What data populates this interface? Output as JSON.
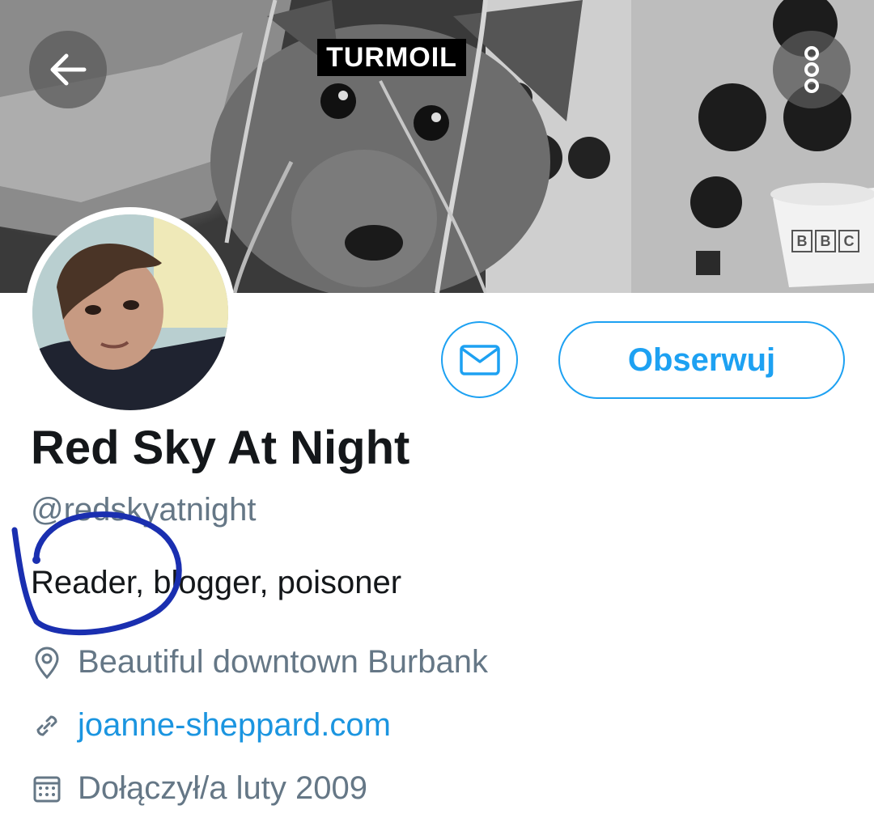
{
  "banner": {
    "title": "TURMOIL",
    "cup_logo": [
      "B",
      "B",
      "C"
    ]
  },
  "nav": {
    "back_icon": "arrow-left-icon",
    "more_icon": "more-vertical-icon"
  },
  "actions": {
    "message_icon": "envelope-icon",
    "follow_label": "Obserwuj"
  },
  "profile": {
    "name": "Red Sky At Night",
    "handle": "@redskyatnight",
    "bio": "Reader, blogger, poisoner",
    "location": "Beautiful downtown Burbank",
    "website": "joanne-sheppard.com",
    "joined": "Dołączył/a luty 2009"
  },
  "colors": {
    "accent": "#1da1f2",
    "link": "#1b95e0",
    "secondary_text": "#657786",
    "primary_text": "#14171a",
    "annotation": "#1a2fb0"
  }
}
